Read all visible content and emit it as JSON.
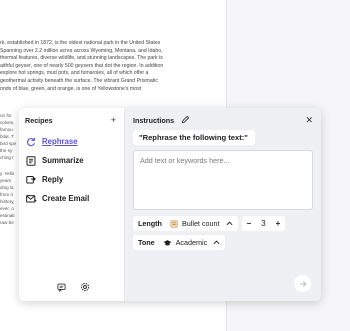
{
  "document": {
    "paragraph_1": "rk, established in 1872, is the oldest national park in the United States\nSpanning over 2.2 million acres across Wyoming, Montana, and Idaho,\nthermal features, diverse wildlife, and stunning landscapes. The park is\naithful geyser, one of nearly 500 geysers that dot the region. In addition\nexplore hot springs, mud pots, and fumaroles, all of which offer a\ngeothermal activity beneath the surface. The vibrant Grand Prismatic\nonds of blue, green, and orange, is one of Yellowstone's most",
    "paragraph_2": "on for\nvolves,\nfamou\nbitat. T\nbird spe\nthe sy\nching t",
    "paragraph_3": "y. Yello\nyears\nding la\nfrom ri\nhistory,\never, o\nestinati\nraw be"
  },
  "recipes": {
    "title": "Recipes",
    "add_label": "+",
    "items": [
      {
        "label": "Rephrase",
        "icon": "rephrase-icon",
        "active": true
      },
      {
        "label": "Summarize",
        "icon": "summarize-icon",
        "active": false
      },
      {
        "label": "Reply",
        "icon": "reply-icon",
        "active": false
      },
      {
        "label": "Create Email",
        "icon": "email-icon",
        "active": false
      }
    ],
    "footer_icons": [
      "chat-icon",
      "settings-icon"
    ]
  },
  "instructions": {
    "title": "Instructions",
    "selected_recipe": "\"Rephrase the following text:\"",
    "input_placeholder": "Add text or keywords here...",
    "input_value": "",
    "length_label": "Length",
    "length_mode": "Bullet count",
    "length_value": "3",
    "minus_label": "−",
    "plus_label": "+",
    "tone_label": "Tone",
    "tone_value": "Academic",
    "close_label": "✕"
  },
  "colors": {
    "accent": "#5b54d6",
    "panel_bg": "#eef0f3"
  }
}
